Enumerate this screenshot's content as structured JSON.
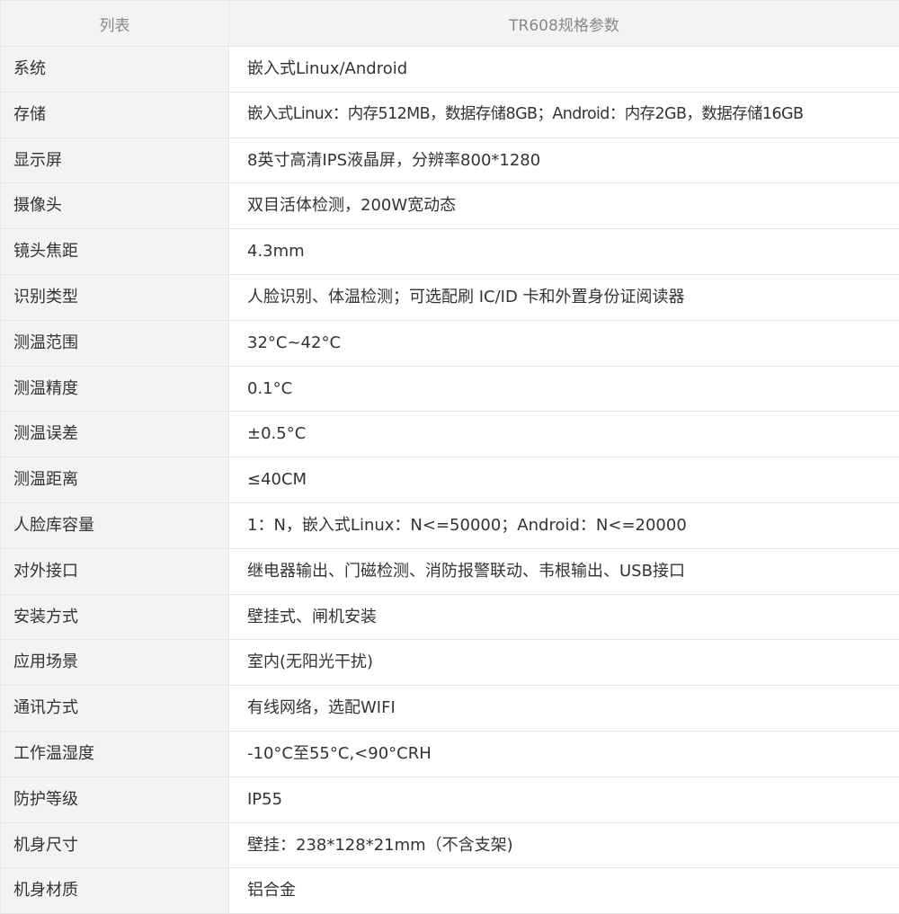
{
  "table": {
    "headers": [
      "列表",
      "TR608规格参数"
    ],
    "rows": [
      [
        "系统",
        "嵌入式Linux/Android"
      ],
      [
        "存储",
        "嵌入式Linux：内存512MB，数据存储8GB；Android：内存2GB，数据存储16GB"
      ],
      [
        "显示屏",
        "8英寸高清IPS液晶屏，分辨率800*1280"
      ],
      [
        "摄像头",
        "双目活体检测，200W宽动态"
      ],
      [
        "镜头焦距",
        "4.3mm"
      ],
      [
        "识别类型",
        "人脸识别、体温检测；可选配刷 IC/ID 卡和外置身份证阅读器"
      ],
      [
        "测温范围",
        "32°C~42°C"
      ],
      [
        "测温精度",
        "0.1°C"
      ],
      [
        "测温误差",
        "±0.5°C"
      ],
      [
        "测温距离",
        "≤40CM"
      ],
      [
        "人脸库容量",
        "1：N，嵌入式Linux：N<=50000；Android：N<=20000"
      ],
      [
        "对外接口",
        "继电器输出、门磁检测、消防报警联动、韦根输出、USB接口"
      ],
      [
        "安装方式",
        "壁挂式、闸机安装"
      ],
      [
        "应用场景",
        "室内(无阳光干扰)"
      ],
      [
        "通讯方式",
        "有线网络，选配WIFI"
      ],
      [
        "工作温湿度",
        "-10°C至55°C,<90°CRH"
      ],
      [
        "防护等级",
        "IP55"
      ],
      [
        "机身尺寸",
        "壁挂：238*128*21mm（不含支架)"
      ],
      [
        "机身材质",
        "铝合金"
      ]
    ]
  }
}
